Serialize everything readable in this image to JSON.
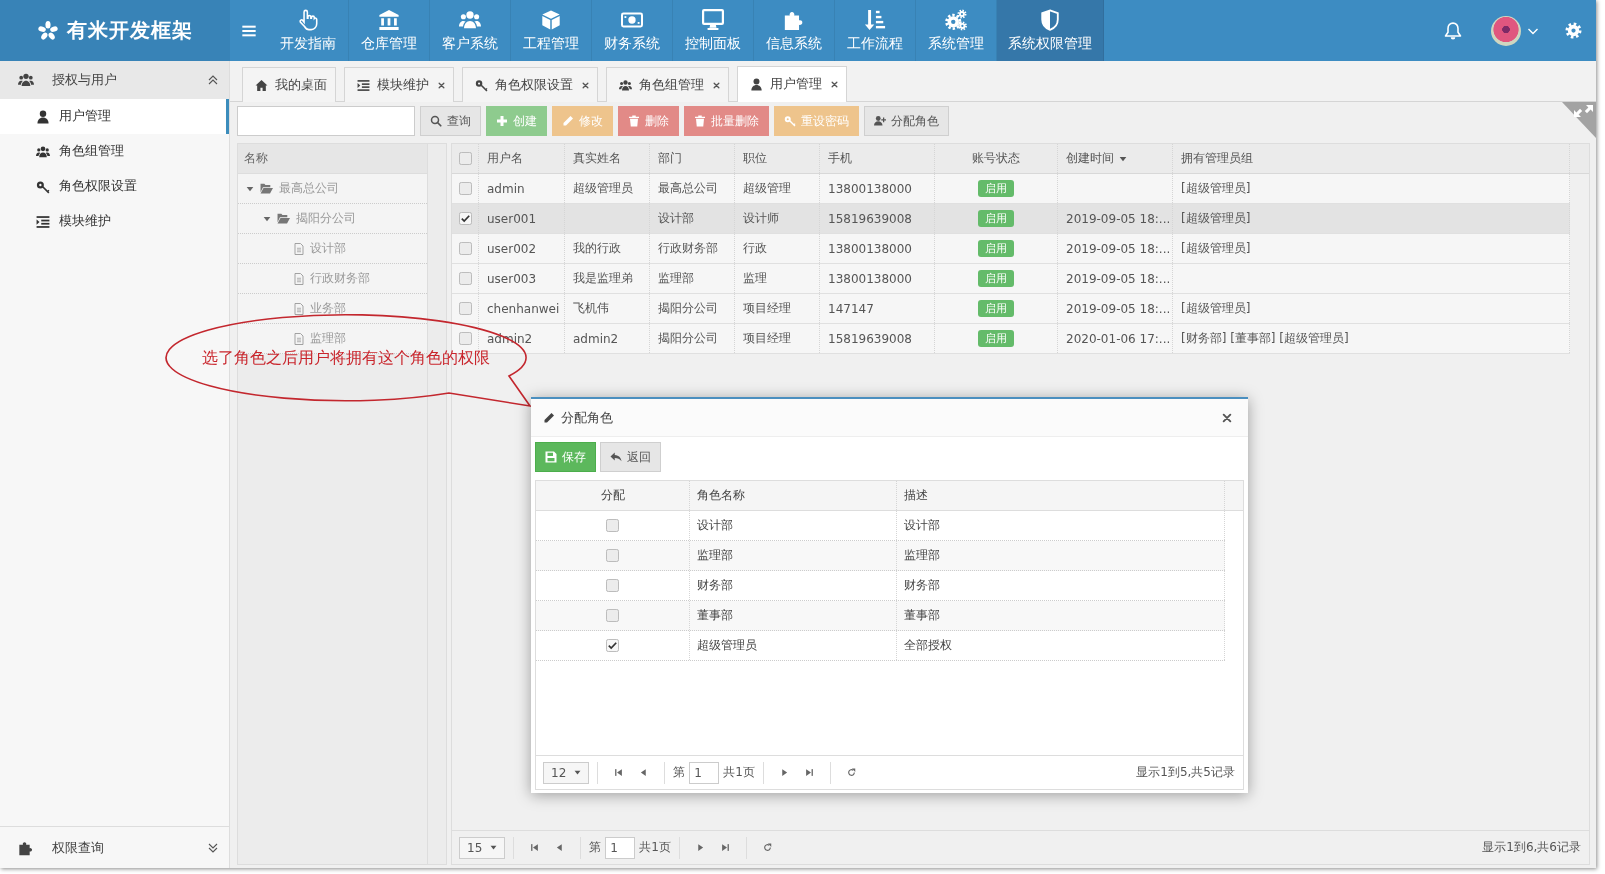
{
  "top_bar": {
    "logo": "有米开发框架",
    "nav": [
      {
        "label": "开发指南",
        "selected": false
      },
      {
        "label": "仓库管理",
        "selected": false
      },
      {
        "label": "客户系统",
        "selected": false
      },
      {
        "label": "工程管理",
        "selected": false
      },
      {
        "label": "财务系统",
        "selected": false
      },
      {
        "label": "控制面板",
        "selected": false
      },
      {
        "label": "信息系统",
        "selected": false
      },
      {
        "label": "工作流程",
        "selected": false
      },
      {
        "label": "系统管理",
        "selected": false
      },
      {
        "label": "系统权限管理",
        "selected": true
      }
    ]
  },
  "sidebar": {
    "groups": [
      {
        "title": "授权与用户",
        "expanded": true,
        "items": [
          {
            "label": "用户管理",
            "selected": true
          },
          {
            "label": "角色组管理",
            "selected": false
          },
          {
            "label": "角色权限设置",
            "selected": false
          },
          {
            "label": "模块维护",
            "selected": false
          }
        ]
      },
      {
        "title": "权限查询",
        "expanded": false
      }
    ]
  },
  "tabs": [
    {
      "label": "我的桌面",
      "closable": false,
      "selected": false
    },
    {
      "label": "模块维护",
      "closable": true,
      "selected": false
    },
    {
      "label": "角色权限设置",
      "closable": true,
      "selected": false
    },
    {
      "label": "角色组管理",
      "closable": true,
      "selected": false
    },
    {
      "label": "用户管理",
      "closable": true,
      "selected": true
    }
  ],
  "toolbar": {
    "buttons": [
      {
        "label": "查询",
        "kind": "default"
      },
      {
        "label": "创建",
        "kind": "success"
      },
      {
        "label": "修改",
        "kind": "warning"
      },
      {
        "label": "删除",
        "kind": "danger"
      },
      {
        "label": "批量删除",
        "kind": "danger"
      },
      {
        "label": "重设密码",
        "kind": "warning"
      },
      {
        "label": "分配角色",
        "kind": "default"
      }
    ]
  },
  "tree": {
    "header": "名称",
    "nodes": [
      {
        "label": "最高总公司",
        "expanded": true,
        "children": [
          {
            "label": "揭阳分公司",
            "expanded": true,
            "children": [
              {
                "label": "设计部"
              },
              {
                "label": "行政财务部"
              },
              {
                "label": "业务部"
              },
              {
                "label": "监理部"
              }
            ]
          }
        ]
      }
    ]
  },
  "grid": {
    "all_checked": false,
    "columns": [
      {
        "label": "用户名",
        "sorted": false
      },
      {
        "label": "真实姓名",
        "sorted": false
      },
      {
        "label": "部门",
        "sorted": false
      },
      {
        "label": "职位",
        "sorted": false
      },
      {
        "label": "手机",
        "sorted": false
      },
      {
        "label": "账号状态",
        "sorted": false
      },
      {
        "label": "创建时间",
        "sorted": true
      },
      {
        "label": "拥有管理员组",
        "sorted": false
      }
    ],
    "rows": [
      {
        "checked": false,
        "selected": false,
        "username": "admin",
        "real_name": "超级管理员",
        "department": "最高总公司",
        "position": "超级管理",
        "phone": "13800138000",
        "status": "启用",
        "groups": "[超级管理员]"
      },
      {
        "checked": true,
        "selected": true,
        "username": "user001",
        "department": "设计部",
        "position": "设计师",
        "phone": "15819639008",
        "status": "启用",
        "created": "2019-09-05 18:...",
        "groups": "[超级管理员]"
      },
      {
        "checked": false,
        "selected": false,
        "username": "user002",
        "real_name": "我的行政",
        "department": "行政财务部",
        "position": "行政",
        "phone": "13800138000",
        "status": "启用",
        "created": "2019-09-05 18:...",
        "groups": "[超级管理员]"
      },
      {
        "checked": false,
        "selected": false,
        "username": "user003",
        "real_name": "我是监理弟",
        "department": "监理部",
        "position": "监理",
        "phone": "13800138000",
        "status": "启用",
        "created": "2019-09-05 18:..."
      },
      {
        "checked": false,
        "selected": false,
        "username": "chenhanwei",
        "real_name": "飞机伟",
        "department": "揭阳分公司",
        "position": "项目经理",
        "phone": "147147",
        "status": "启用",
        "created": "2019-09-05 18:...",
        "groups": "[超级管理员]"
      },
      {
        "checked": false,
        "selected": false,
        "username": "admin2",
        "real_name": "admin2",
        "department": "揭阳分公司",
        "position": "项目经理",
        "phone": "15819639008",
        "status": "启用",
        "created": "2020-01-06 17:...",
        "groups": "[财务部] [董事部] [超级管理员]"
      }
    ],
    "pager": {
      "page_size": "15",
      "page_prefix": "第",
      "page": "1",
      "page_suffix": "共1页",
      "summary": "显示1到6,共6记录"
    }
  },
  "dialog": {
    "title": "分配角色",
    "buttons": [
      {
        "label": "保存",
        "kind": "success"
      },
      {
        "label": "返回",
        "kind": "default"
      }
    ],
    "columns": [
      {
        "label": "分配"
      },
      {
        "label": "角色名称"
      },
      {
        "label": "描述"
      }
    ],
    "rows": [
      {
        "checked": false,
        "name": "设计部",
        "description": "设计部"
      },
      {
        "checked": false,
        "name": "监理部",
        "description": "监理部"
      },
      {
        "checked": false,
        "name": "财务部",
        "description": "财务部"
      },
      {
        "checked": false,
        "name": "董事部",
        "description": "董事部"
      },
      {
        "checked": true,
        "name": "超级管理员",
        "description": "全部授权"
      }
    ],
    "pager": {
      "page_size": "12",
      "page_prefix": "第",
      "page": "1",
      "page_suffix": "共1页",
      "summary": "显示1到5,共5记录"
    }
  },
  "callout": {
    "text": "选了角色之后用户将拥有这个角色的权限"
  }
}
